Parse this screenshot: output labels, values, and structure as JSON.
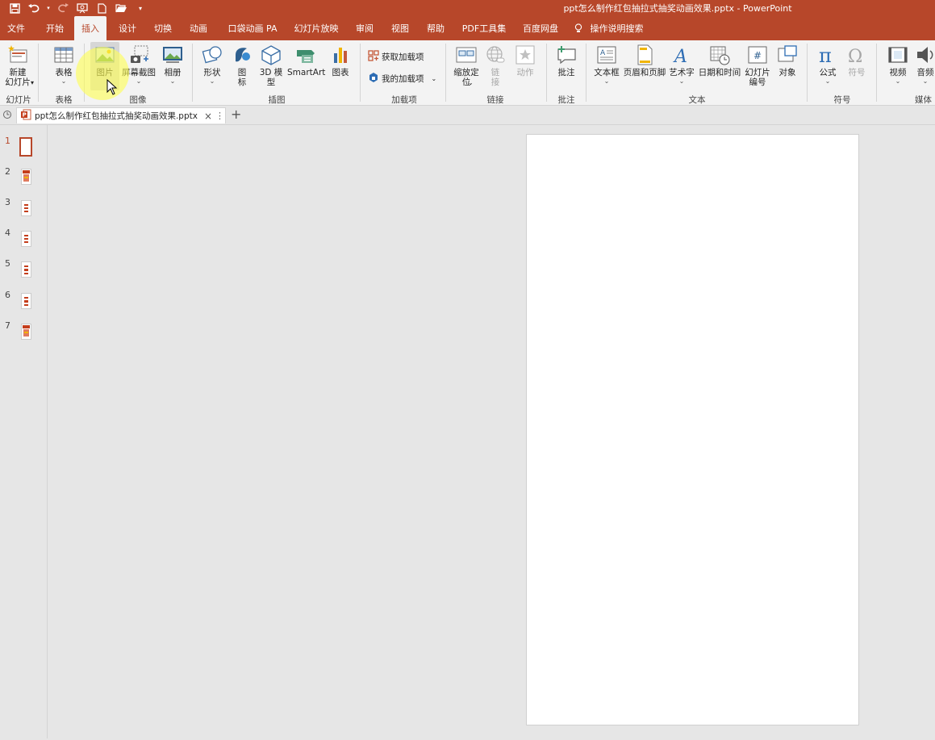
{
  "window": {
    "document_title": "ppt怎么制作红包抽拉式抽奖动画效果.pptx  -  PowerPoint"
  },
  "quick_access": [
    "save-icon",
    "undo-icon",
    "redo-icon",
    "present-icon",
    "new-icon",
    "open-icon",
    "customize-icon"
  ],
  "tabs": [
    {
      "label": "文件",
      "active": false
    },
    {
      "label": "开始",
      "active": false
    },
    {
      "label": "插入",
      "active": true
    },
    {
      "label": "设计",
      "active": false
    },
    {
      "label": "切换",
      "active": false
    },
    {
      "label": "动画",
      "active": false
    },
    {
      "label": "口袋动画 PA",
      "active": false
    },
    {
      "label": "幻灯片放映",
      "active": false
    },
    {
      "label": "审阅",
      "active": false
    },
    {
      "label": "视图",
      "active": false
    },
    {
      "label": "帮助",
      "active": false
    },
    {
      "label": "PDF工具集",
      "active": false
    },
    {
      "label": "百度网盘",
      "active": false
    }
  ],
  "tell_me": "操作说明搜索",
  "ribbon": {
    "new_slide": "新建\n幻灯片",
    "table": "表格",
    "picture": "图片",
    "screenshot": "屏幕截图",
    "album": "相册",
    "shapes": "形状",
    "icons": "图\n标",
    "model3d": "3D 模\n型",
    "smartart": "SmartArt",
    "chart": "图表",
    "get_addins": "获取加载项",
    "my_addins": "我的加载项",
    "zoom": "缩放定\n位",
    "link": "链\n接",
    "action": "动作",
    "comment": "批注",
    "textbox": "文本框",
    "header_footer": "页眉和页脚",
    "wordart": "艺术字",
    "datetime": "日期和时间",
    "slide_number": "幻灯片\n编号",
    "object": "对象",
    "equation": "公式",
    "symbol": "符号",
    "video": "视频",
    "audio": "音频",
    "groups": {
      "slides": "幻灯片",
      "tables": "表格",
      "images": "图像",
      "illustrations": "插图",
      "addins": "加载项",
      "links": "链接",
      "comments": "批注",
      "text": "文本",
      "symbols": "符号",
      "media": "媒体"
    }
  },
  "doc_tab": {
    "name": "ppt怎么制作红包抽拉式抽奖动画效果.pptx",
    "close": "×",
    "more": "⋮",
    "add": "+"
  },
  "thumbnails": [
    "1",
    "2",
    "3",
    "4",
    "5",
    "6",
    "7"
  ],
  "colors": {
    "accent": "#b7472a",
    "ribbon_bg": "#f3f3f3",
    "workspace": "#e6e6e6"
  }
}
